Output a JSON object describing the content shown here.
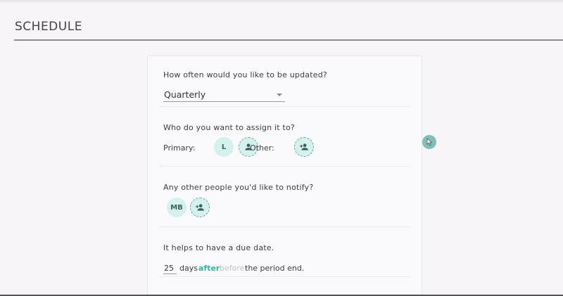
{
  "header": {
    "title": "SCHEDULE"
  },
  "frequency": {
    "question": "How often would you like to be updated?",
    "selected": "Quarterly"
  },
  "assign": {
    "question": "Who do you want to assign it to?",
    "primary_label": "Primary:",
    "primary_avatar": "L",
    "other_label": "Other:"
  },
  "notify": {
    "question": "Any other people you'd like to notify?",
    "avatar": "MB"
  },
  "due": {
    "question": "It helps to have a due date.",
    "days_value": "25",
    "days_label": "days",
    "after_label": "after",
    "before_label": "before",
    "suffix": "the period end."
  },
  "colors": {
    "accent": "#38b2a2",
    "avatar_bg": "#d5f1ee",
    "page_bg": "#f7f5f8"
  },
  "icons": {
    "assign_primary_add": "person-icon",
    "assign_other_add": "person-add-icon",
    "notify_add": "person-add-icon",
    "cursor": "cursor-icon"
  }
}
